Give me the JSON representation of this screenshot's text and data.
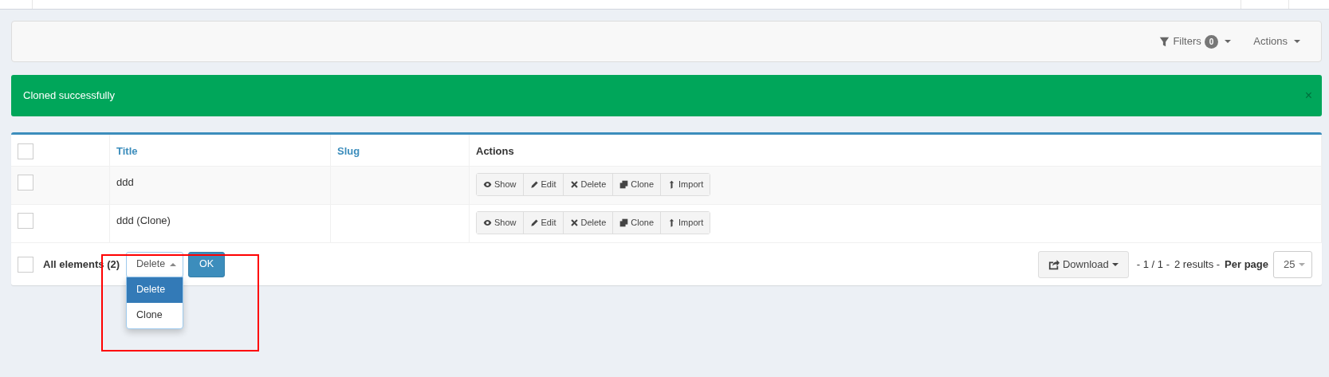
{
  "filter_bar": {
    "filters_label": "Filters",
    "filters_count": "0",
    "actions_label": "Actions"
  },
  "alert": {
    "message": "Cloned successfully",
    "close": "×"
  },
  "table": {
    "header_checked": false,
    "columns": [
      {
        "label": "Title",
        "sortable": true
      },
      {
        "label": "Slug",
        "sortable": true
      },
      {
        "label": "Actions",
        "sortable": false
      }
    ],
    "rows": [
      {
        "checked": false,
        "title": "ddd",
        "actions": [
          {
            "kind": "show",
            "label": "Show"
          },
          {
            "kind": "edit",
            "label": "Edit"
          },
          {
            "kind": "delete",
            "label": "Delete"
          },
          {
            "kind": "clone",
            "label": "Clone"
          },
          {
            "kind": "import",
            "label": "Import"
          }
        ]
      },
      {
        "checked": false,
        "title": "ddd (Clone)",
        "actions": [
          {
            "kind": "show",
            "label": "Show"
          },
          {
            "kind": "edit",
            "label": "Edit"
          },
          {
            "kind": "delete",
            "label": "Delete"
          },
          {
            "kind": "clone",
            "label": "Clone"
          },
          {
            "kind": "import",
            "label": "Import"
          }
        ]
      }
    ]
  },
  "footer": {
    "select_all_checked": false,
    "all_elements": "All elements (2)",
    "batch_select": {
      "value": "Delete",
      "expanded": true,
      "options": [
        {
          "label": "Delete",
          "selected": true
        },
        {
          "label": "Clone",
          "selected": false
        }
      ]
    },
    "ok": "OK",
    "download": "Download",
    "page_info": "- 1 / 1 -",
    "results": "2 results -",
    "per_page_label": "Per page",
    "per_page_value": "25"
  },
  "annotation": {
    "kind": "rectangle"
  }
}
